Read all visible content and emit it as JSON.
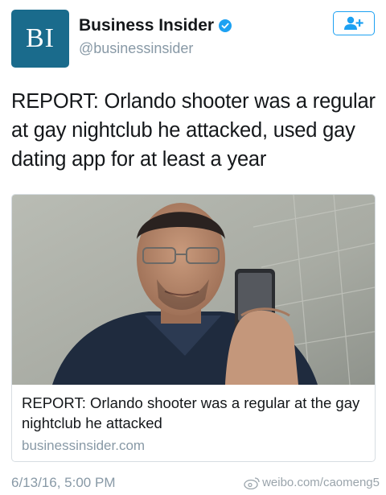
{
  "account": {
    "avatar_text": "BI",
    "avatar_color": "#1a6b8c",
    "display_name": "Business Insider",
    "handle": "@businessinsider",
    "verified_icon": "verified-badge-icon",
    "follow_icon": "add-user-icon"
  },
  "tweet": {
    "text": "REPORT: Orlando shooter was a regular at gay nightclub he attacked, used gay dating app for at least a year",
    "timestamp": "6/13/16, 5:00 PM"
  },
  "card": {
    "title": "REPORT: Orlando shooter was a regular at the gay nightclub he attacked",
    "domain": "businessinsider.com"
  },
  "watermark": {
    "text": "weibo.com/caomeng5",
    "icon": "weibo-logo-icon"
  },
  "colors": {
    "accent": "#1da1f2",
    "secondary_text": "#8899a6"
  }
}
